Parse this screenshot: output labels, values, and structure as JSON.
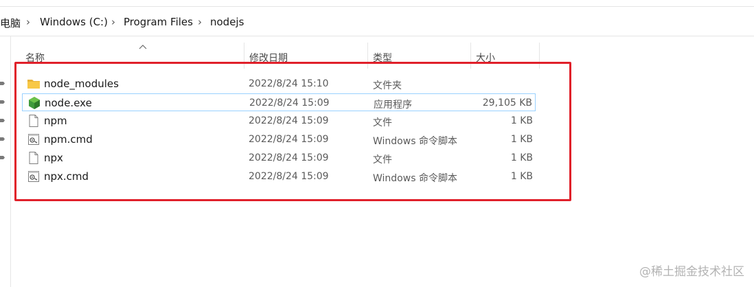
{
  "breadcrumb": {
    "items": [
      "电脑",
      "Windows (C:)",
      "Program Files",
      "nodejs"
    ],
    "separator": "›"
  },
  "columns": {
    "name": "名称",
    "date": "修改日期",
    "type": "类型",
    "size": "大小"
  },
  "files": [
    {
      "name": "node_modules",
      "date": "2022/8/24 15:10",
      "type": "文件夹",
      "size": "",
      "icon": "folder-icon",
      "selected": false
    },
    {
      "name": "node.exe",
      "date": "2022/8/24 15:09",
      "type": "应用程序",
      "size": "29,105 KB",
      "icon": "nodejs-app-icon",
      "selected": true
    },
    {
      "name": "npm",
      "date": "2022/8/24 15:09",
      "type": "文件",
      "size": "1 KB",
      "icon": "file-icon",
      "selected": false
    },
    {
      "name": "npm.cmd",
      "date": "2022/8/24 15:09",
      "type": "Windows 命令脚本",
      "size": "1 KB",
      "icon": "cmd-script-icon",
      "selected": false
    },
    {
      "name": "npx",
      "date": "2022/8/24 15:09",
      "type": "文件",
      "size": "1 KB",
      "icon": "file-icon",
      "selected": false
    },
    {
      "name": "npx.cmd",
      "date": "2022/8/24 15:09",
      "type": "Windows 命令脚本",
      "size": "1 KB",
      "icon": "cmd-script-icon",
      "selected": false
    }
  ],
  "watermark": "@稀土掘金技术社区",
  "colors": {
    "highlight_border": "#e0202a",
    "selection_border": "#99d1ff",
    "folder_yellow": "#f8c846",
    "nodejs_green": "#3f9a3c"
  }
}
